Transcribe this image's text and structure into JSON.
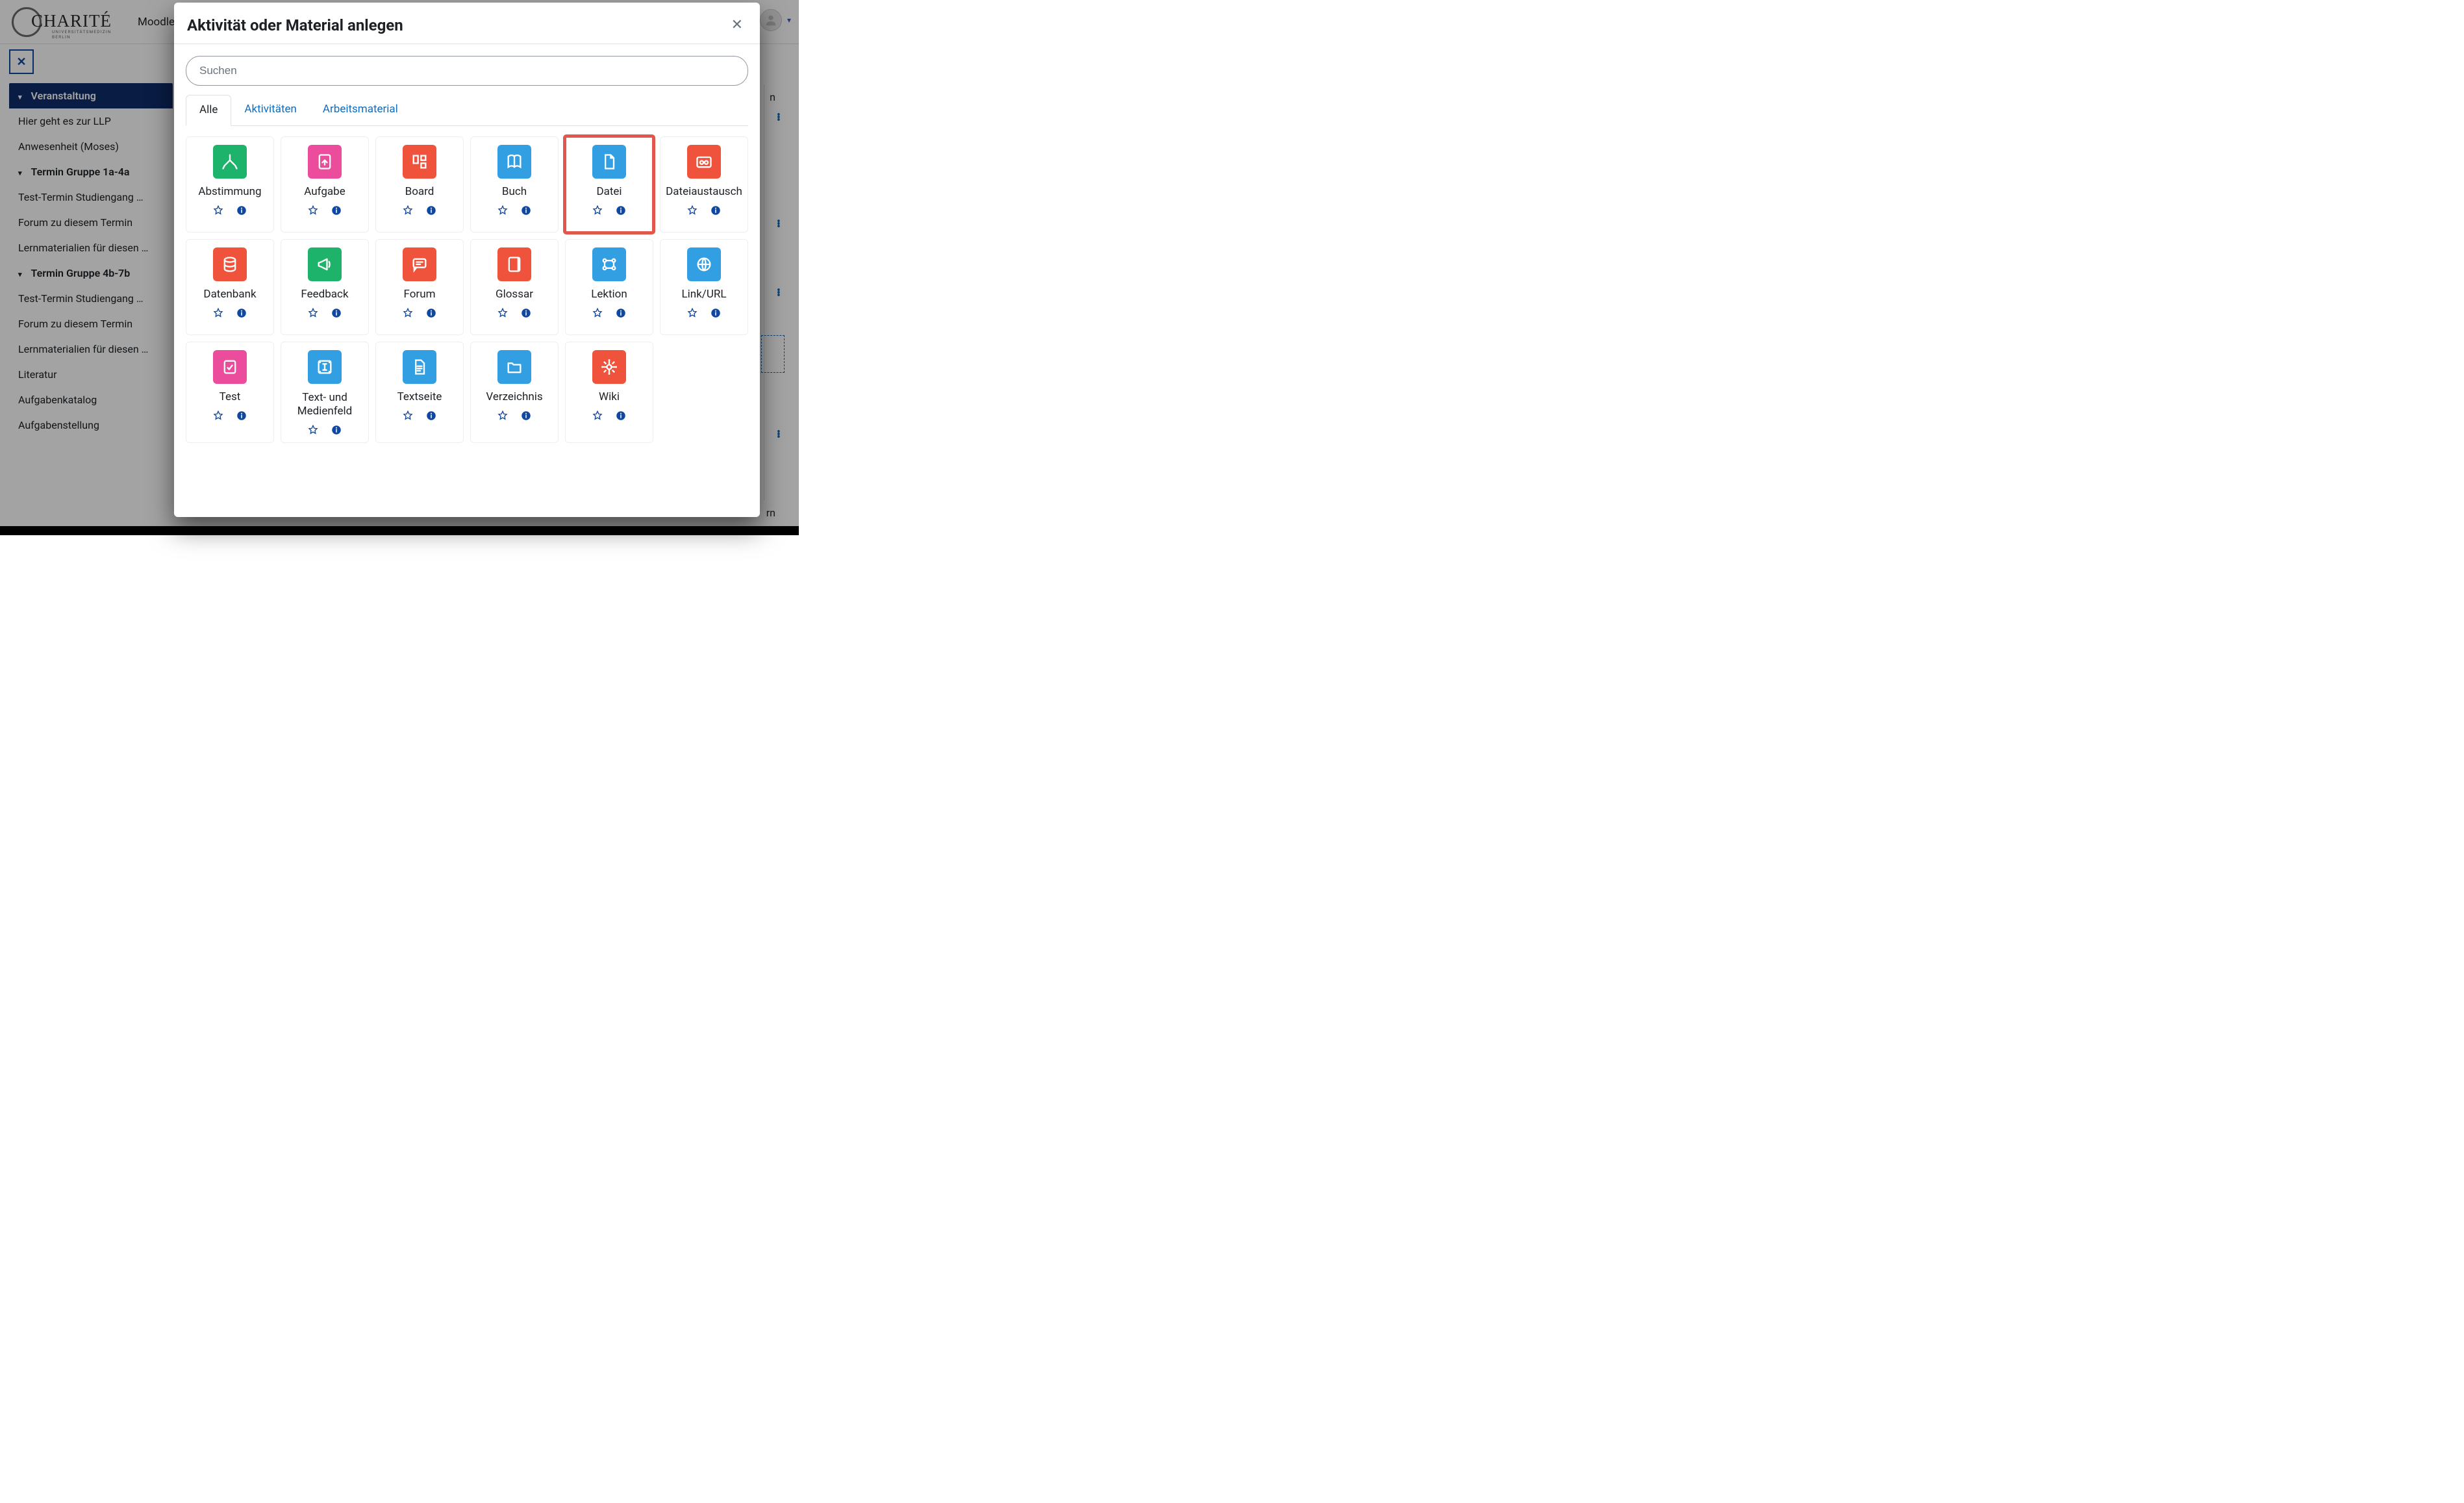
{
  "topbar": {
    "brand": "CHARITÉ",
    "brand_sub": "UNIVERSITÄTSMEDIZIN BERLIN",
    "title_partial": "Moodle"
  },
  "right_edge": {
    "text1": "n",
    "text2": "rn"
  },
  "sidebar": {
    "expanded_section": "Veranstaltung",
    "items": [
      {
        "label": "Hier geht es zur LLP"
      },
      {
        "label": "Anwesenheit (Moses)"
      }
    ],
    "group1_head": "Termin Gruppe 1a-4a",
    "group1": [
      {
        "label": "Test-Termin Studiengang …"
      },
      {
        "label": "Forum zu diesem Termin"
      },
      {
        "label": "Lernmaterialien für diesen …"
      }
    ],
    "group2_head": "Termin Gruppe 4b-7b",
    "group2": [
      {
        "label": "Test-Termin Studiengang …"
      },
      {
        "label": "Forum zu diesem Termin"
      },
      {
        "label": "Lernmaterialien für diesen …"
      },
      {
        "label": "Literatur"
      },
      {
        "label": "Aufgabenkatalog"
      },
      {
        "label": "Aufgabenstellung"
      }
    ]
  },
  "modal": {
    "title": "Aktivität oder Material anlegen",
    "search_placeholder": "Suchen",
    "tabs": {
      "all": "Alle",
      "activities": "Aktivitäten",
      "resources": "Arbeitsmaterial"
    },
    "cards": [
      {
        "id": "abstimmung",
        "label": "Abstimmung",
        "icon": "choice",
        "color": "green"
      },
      {
        "id": "aufgabe",
        "label": "Aufgabe",
        "icon": "assign",
        "color": "pink"
      },
      {
        "id": "board",
        "label": "Board",
        "icon": "board",
        "color": "orange"
      },
      {
        "id": "buch",
        "label": "Buch",
        "icon": "book",
        "color": "blue"
      },
      {
        "id": "datei",
        "label": "Datei",
        "icon": "file",
        "color": "blue",
        "highlight": true
      },
      {
        "id": "dateiaustausch",
        "label": "Dateiaustausch",
        "icon": "fileshare",
        "color": "orange"
      },
      {
        "id": "datenbank",
        "label": "Datenbank",
        "icon": "database",
        "color": "orange"
      },
      {
        "id": "feedback",
        "label": "Feedback",
        "icon": "megaphone",
        "color": "green"
      },
      {
        "id": "forum",
        "label": "Forum",
        "icon": "forum",
        "color": "orange"
      },
      {
        "id": "glossar",
        "label": "Glossar",
        "icon": "glossary",
        "color": "orange"
      },
      {
        "id": "lektion",
        "label": "Lektion",
        "icon": "lesson",
        "color": "blue"
      },
      {
        "id": "link",
        "label": "Link/URL",
        "icon": "globe",
        "color": "blue"
      },
      {
        "id": "test",
        "label": "Test",
        "icon": "quiz",
        "color": "pink"
      },
      {
        "id": "textfeld",
        "label": "Text- und Medienfeld",
        "icon": "label",
        "color": "blue"
      },
      {
        "id": "textseite",
        "label": "Textseite",
        "icon": "page",
        "color": "blue"
      },
      {
        "id": "verzeichnis",
        "label": "Verzeichnis",
        "icon": "folder",
        "color": "blue"
      },
      {
        "id": "wiki",
        "label": "Wiki",
        "icon": "wiki",
        "color": "orange"
      }
    ]
  }
}
